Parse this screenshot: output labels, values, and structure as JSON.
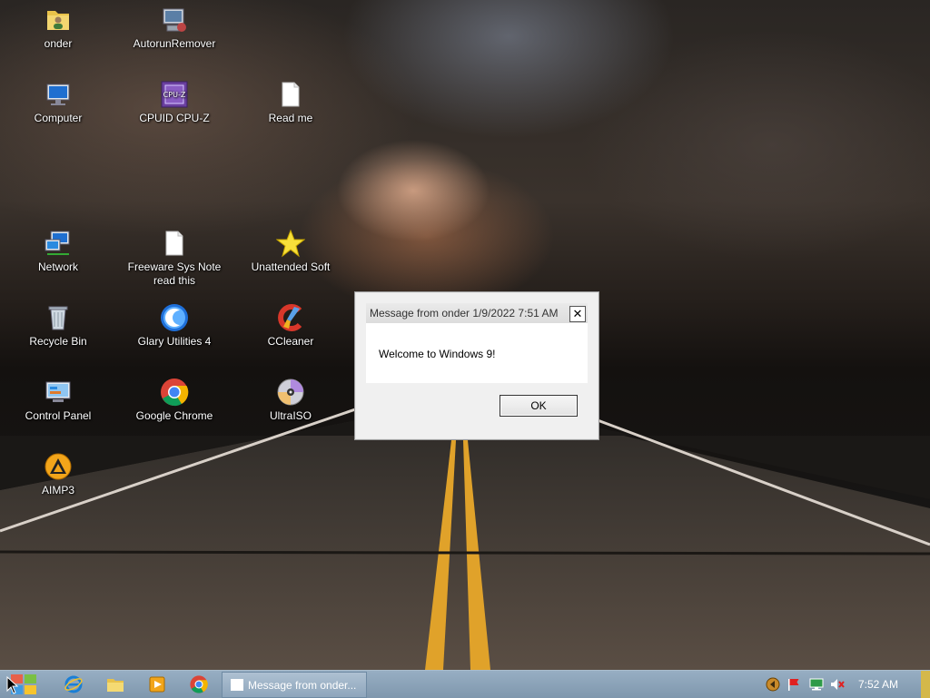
{
  "desktop": {
    "icons": [
      {
        "label": "onder",
        "icon": "user-folder-icon"
      },
      {
        "label": "AutorunRemover",
        "icon": "computer-tool-icon"
      },
      {
        "label": "Computer",
        "icon": "computer-icon"
      },
      {
        "label": "CPUID CPU-Z",
        "icon": "cpuz-icon",
        "badge": "CPU-Z"
      },
      {
        "label": "Read me",
        "icon": "document-icon"
      },
      {
        "label": "Network",
        "icon": "network-icon"
      },
      {
        "label": "Freeware Sys Note read this",
        "icon": "document-icon"
      },
      {
        "label": "Unattended Soft",
        "icon": "star-icon"
      },
      {
        "label": "Recycle Bin",
        "icon": "recycle-bin-icon"
      },
      {
        "label": "Glary Utilities 4",
        "icon": "glary-utilities-icon"
      },
      {
        "label": "CCleaner",
        "icon": "ccleaner-icon"
      },
      {
        "label": "Control Panel",
        "icon": "control-panel-icon"
      },
      {
        "label": "Google Chrome",
        "icon": "chrome-icon"
      },
      {
        "label": "UltraISO",
        "icon": "disc-icon"
      },
      {
        "label": "AIMP3",
        "icon": "aimp-icon"
      }
    ]
  },
  "dialog": {
    "title": "Message from onder 1/9/2022 7:51 AM",
    "close_glyph": "✕",
    "message": "Welcome to Windows 9!",
    "ok_label": "OK"
  },
  "taskbar": {
    "pinned": [
      "internet-explorer-icon",
      "file-explorer-icon",
      "media-player-icon",
      "chrome-icon"
    ],
    "active_task": "Message from onder...",
    "tray": [
      "aimp-tray-icon",
      "action-center-flag-icon",
      "network-tray-icon",
      "volume-muted-icon"
    ],
    "clock": "7:52 AM"
  },
  "colors": {
    "taskbar": "#8aa2b8",
    "dialog_bg": "#f0f0f0"
  }
}
